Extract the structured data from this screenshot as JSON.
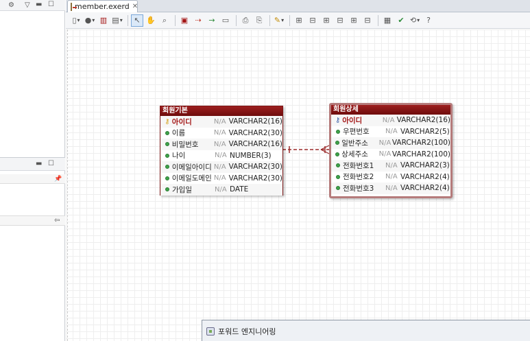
{
  "editor": {
    "tab_label": "member.exerd",
    "tab_close": "✕"
  },
  "tables": [
    {
      "title": "회원기본",
      "columns": [
        {
          "name": "아이디",
          "na": "N/A",
          "type": "VARCHAR2(16)",
          "pk": true
        },
        {
          "name": "이름",
          "na": "N/A",
          "type": "VARCHAR2(30)",
          "pk": false
        },
        {
          "name": "비밀번호",
          "na": "N/A",
          "type": "VARCHAR2(16)",
          "pk": false
        },
        {
          "name": "나이",
          "na": "N/A",
          "type": "NUMBER(3)",
          "pk": false
        },
        {
          "name": "이메일아이디",
          "na": "N/A",
          "type": "VARCHAR2(30)",
          "pk": false
        },
        {
          "name": "이메일도메인",
          "na": "N/A",
          "type": "VARCHAR2(30)",
          "pk": false
        },
        {
          "name": "가입일",
          "na": "N/A",
          "type": "DATE",
          "pk": false
        }
      ]
    },
    {
      "title": "회원상세",
      "columns": [
        {
          "name": "아이디",
          "na": "N/A",
          "type": "VARCHAR2(16)",
          "pk": true
        },
        {
          "name": "우편번호",
          "na": "N/A",
          "type": "VARCHAR2(5)",
          "pk": false
        },
        {
          "name": "일반주소",
          "na": "N/A",
          "type": "VARCHAR2(100)",
          "pk": false
        },
        {
          "name": "상세주소",
          "na": "N/A",
          "type": "VARCHAR2(100)",
          "pk": false
        },
        {
          "name": "전화번호1",
          "na": "N/A",
          "type": "VARCHAR2(3)",
          "pk": false
        },
        {
          "name": "전화번호2",
          "na": "N/A",
          "type": "VARCHAR2(4)",
          "pk": false
        },
        {
          "name": "전화번호3",
          "na": "N/A",
          "type": "VARCHAR2(4)",
          "pk": false
        }
      ]
    }
  ],
  "dialog": {
    "title": "포워드 엔지니어링"
  },
  "colors": {
    "table_header": "#8b1414",
    "relationship_line": "#9b2a2a",
    "column_dot": "#3fa24a",
    "pk_key": "#d4a017"
  },
  "icons": {
    "left_panel": [
      "panel-icon",
      "view-menu-icon",
      "minimize-icon",
      "maximize-icon",
      "pin-icon",
      "collapse-icon"
    ],
    "toolbar": [
      "layout-icon",
      "shape-icon",
      "entity-icon",
      "document-icon",
      "select-icon",
      "hand-icon",
      "zoom-icon",
      "table-icon",
      "relation-icon",
      "link-icon",
      "note-icon",
      "print-icon",
      "paint-icon",
      "align-icon",
      "validate-icon",
      "forward-engineer-icon",
      "help-icon"
    ]
  }
}
